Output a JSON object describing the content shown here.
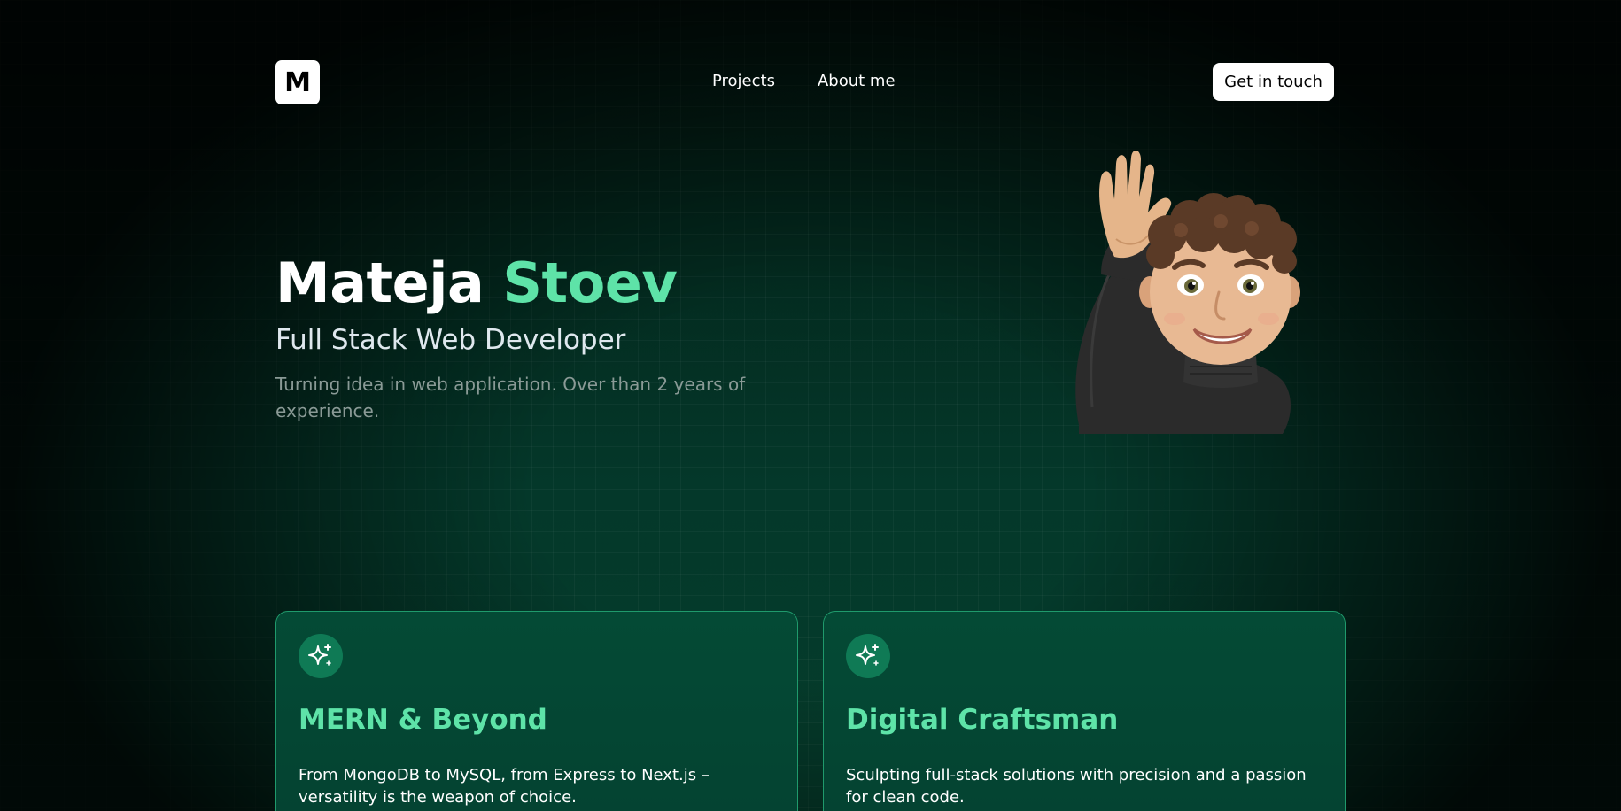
{
  "nav": {
    "logo_letter": "M",
    "links": [
      {
        "label": "Projects"
      },
      {
        "label": "About me"
      }
    ],
    "cta_label": "Get in touch"
  },
  "hero": {
    "first_name": "Mateja",
    "last_name": "Stoev",
    "role": "Full Stack Web Developer",
    "description": "Turning idea in web application. Over than 2 years of experience.",
    "avatar_icon": "waving-memoji-icon"
  },
  "cards": [
    {
      "icon": "sparkle-icon",
      "title": "MERN & Beyond",
      "text": "From MongoDB to MySQL, from Express to Next.js – versatility is the weapon of choice."
    },
    {
      "icon": "sparkle-icon",
      "title": "Digital Craftsman",
      "text": "Sculpting full-stack solutions with precision and a passion for clean code."
    }
  ],
  "colors": {
    "accent": "#5ee3a8",
    "background": "#03251a",
    "card_bg": "#044a35",
    "card_border": "#1f9a6c",
    "icon_circle": "#0f7a55",
    "muted_text": "#8a9a96"
  }
}
